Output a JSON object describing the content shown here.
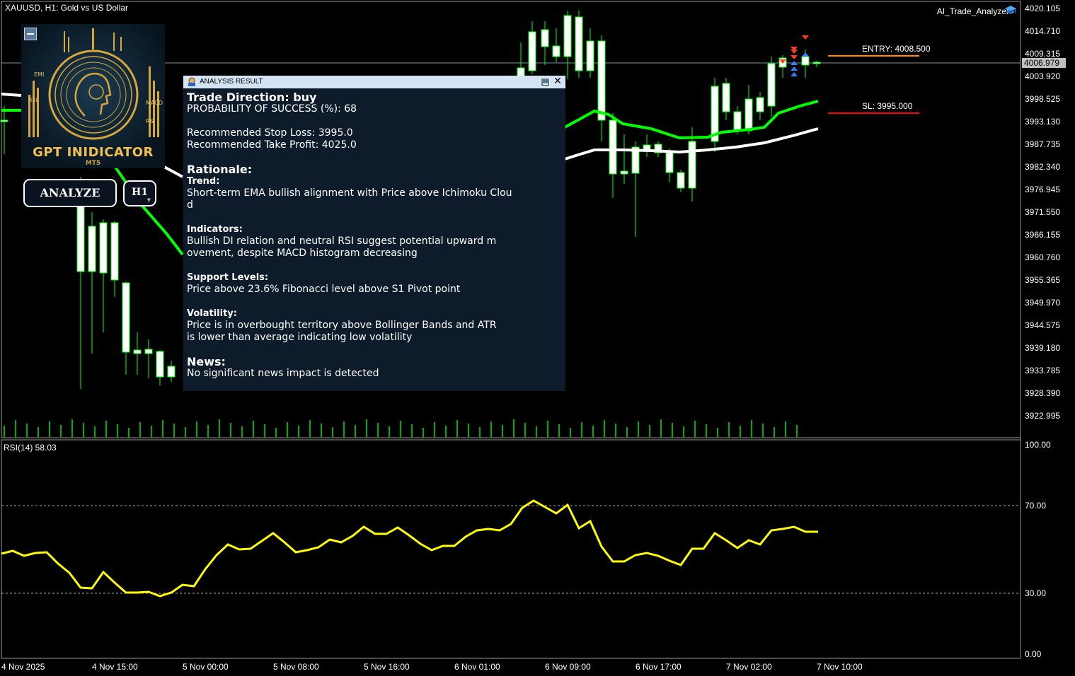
{
  "chart_header": {
    "symbol_title": "XAUUSD, H1:  Gold vs US Dollar",
    "ea_name": "AI_Trade_Analyzer"
  },
  "price_axis": [
    "4020.105",
    "4014.710",
    "4009.315",
    "4003.920",
    "3998.525",
    "3993.130",
    "3987.735",
    "3982.340",
    "3976.945",
    "3971.550",
    "3966.155",
    "3960.760",
    "3955.365",
    "3949.970",
    "3944.575",
    "3939.180",
    "3933.785",
    "3928.390",
    "3922.995"
  ],
  "current_price": "4006.979",
  "levels": {
    "entry_label": "ENTRY: 4008.500",
    "sl_label": "SL: 3995.000",
    "entry_color": "#ff8c1a",
    "sl_color": "#ff0000"
  },
  "rsi": {
    "title": "RSI(14) 58.03",
    "axis": [
      "100.00",
      "70.00",
      "30.00",
      "0.00"
    ]
  },
  "time_axis": [
    "4 Nov 2025",
    "4 Nov 15:00",
    "5 Nov 00:00",
    "5 Nov 08:00",
    "5 Nov 16:00",
    "6 Nov 01:00",
    "6 Nov 09:00",
    "6 Nov 17:00",
    "7 Nov 02:00",
    "7 Nov 10:00"
  ],
  "logo": {
    "title": "GPT INIDICATOR",
    "subtitle": "MT5",
    "labels": [
      "EMI",
      "RSI",
      "MACD",
      "RSI"
    ]
  },
  "controls": {
    "analyze_label": "ANALYZE",
    "timeframe_label": "H1"
  },
  "dialog": {
    "title": "ANALYSIS RESULT",
    "trade_direction": "Trade Direction: buy",
    "probability": "PROBABILITY OF SUCCESS (%): 68",
    "stop_loss": "Recommended Stop Loss: 3995.0",
    "take_profit": "Recommended Take Profit: 4025.0",
    "rationale_heading": "Rationale:",
    "trend_heading": "Trend:",
    "trend_text": "Short-term EMA bullish alignment with Price above Ichimoku Cloud",
    "indicators_heading": "Indicators:",
    "indicators_text": "Bullish DI relation and neutral RSI suggest potential upward movement, despite MACD histogram decreasing",
    "support_heading": "Support Levels:",
    "support_text": "Price above 23.6% Fibonacci level above S1 Pivot point",
    "volatility_heading": "Volatility:",
    "volatility_text": "Price is in overbought territory above Bollinger Bands and ATR\nis lower than average indicating low volatility",
    "news_heading": "News:",
    "news_text": "No significant news impact is detected"
  },
  "colors": {
    "up_candle": "#ffffff",
    "wick": "#00ff00",
    "ema_fast": "#00ff00",
    "ema_slow": "#ffffff",
    "rsi_line": "#ffff00",
    "volume": "#00c000"
  }
}
